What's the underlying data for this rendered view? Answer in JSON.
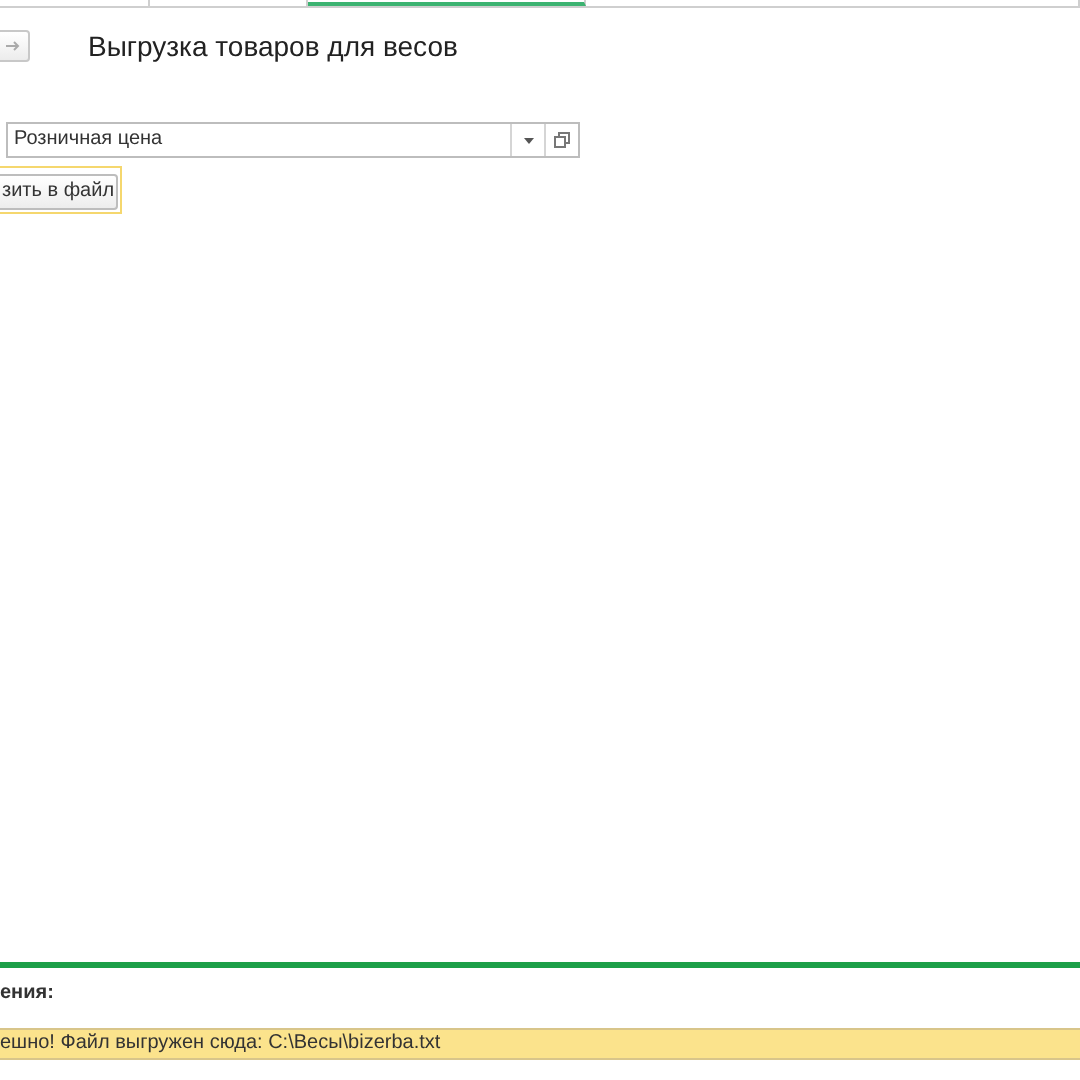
{
  "title": "Выгрузка товаров для весов",
  "price_type": {
    "value": "Розничная цена"
  },
  "export_button": {
    "label": "зить в файл",
    "focused": true
  },
  "messages": {
    "label": "ения:",
    "items": [
      "ешно! Файл выгружен сюда: C:\\Весы\\bizerba.txt"
    ]
  }
}
